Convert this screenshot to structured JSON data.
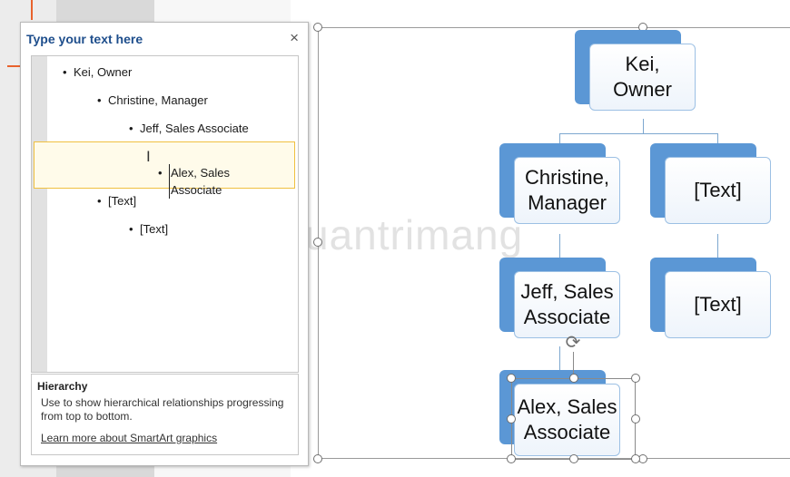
{
  "text_pane": {
    "title": "Type your text here",
    "close_label": "×",
    "items": [
      {
        "level": 1,
        "text": "Kei, Owner"
      },
      {
        "level": 2,
        "text": "Christine, Manager"
      },
      {
        "level": 3,
        "text": "Jeff, Sales Associate"
      },
      {
        "level": 4,
        "text": "Alex, Sales\nAssociate"
      },
      {
        "level": 2,
        "text": "[Text]"
      },
      {
        "level": 3,
        "text": "[Text]"
      }
    ],
    "help": {
      "title": "Hierarchy",
      "description": "Use to show hierarchical relationships progressing from top to bottom.",
      "link": "Learn more about SmartArt graphics"
    }
  },
  "org_chart": {
    "nodes": [
      {
        "id": "kei",
        "text": "Kei,\nOwner"
      },
      {
        "id": "christine",
        "text": "Christine,\nManager"
      },
      {
        "id": "text1",
        "text": "[Text]"
      },
      {
        "id": "jeff",
        "text": "Jeff, Sales\nAssociate"
      },
      {
        "id": "text2",
        "text": "[Text]"
      },
      {
        "id": "alex",
        "text": "Alex, Sales\nAssociate"
      }
    ]
  },
  "watermark": "uantrimang",
  "colors": {
    "shape_fill": "#5b97d5",
    "title_blue": "#1e4e8c",
    "active_row": "#f0c040"
  }
}
